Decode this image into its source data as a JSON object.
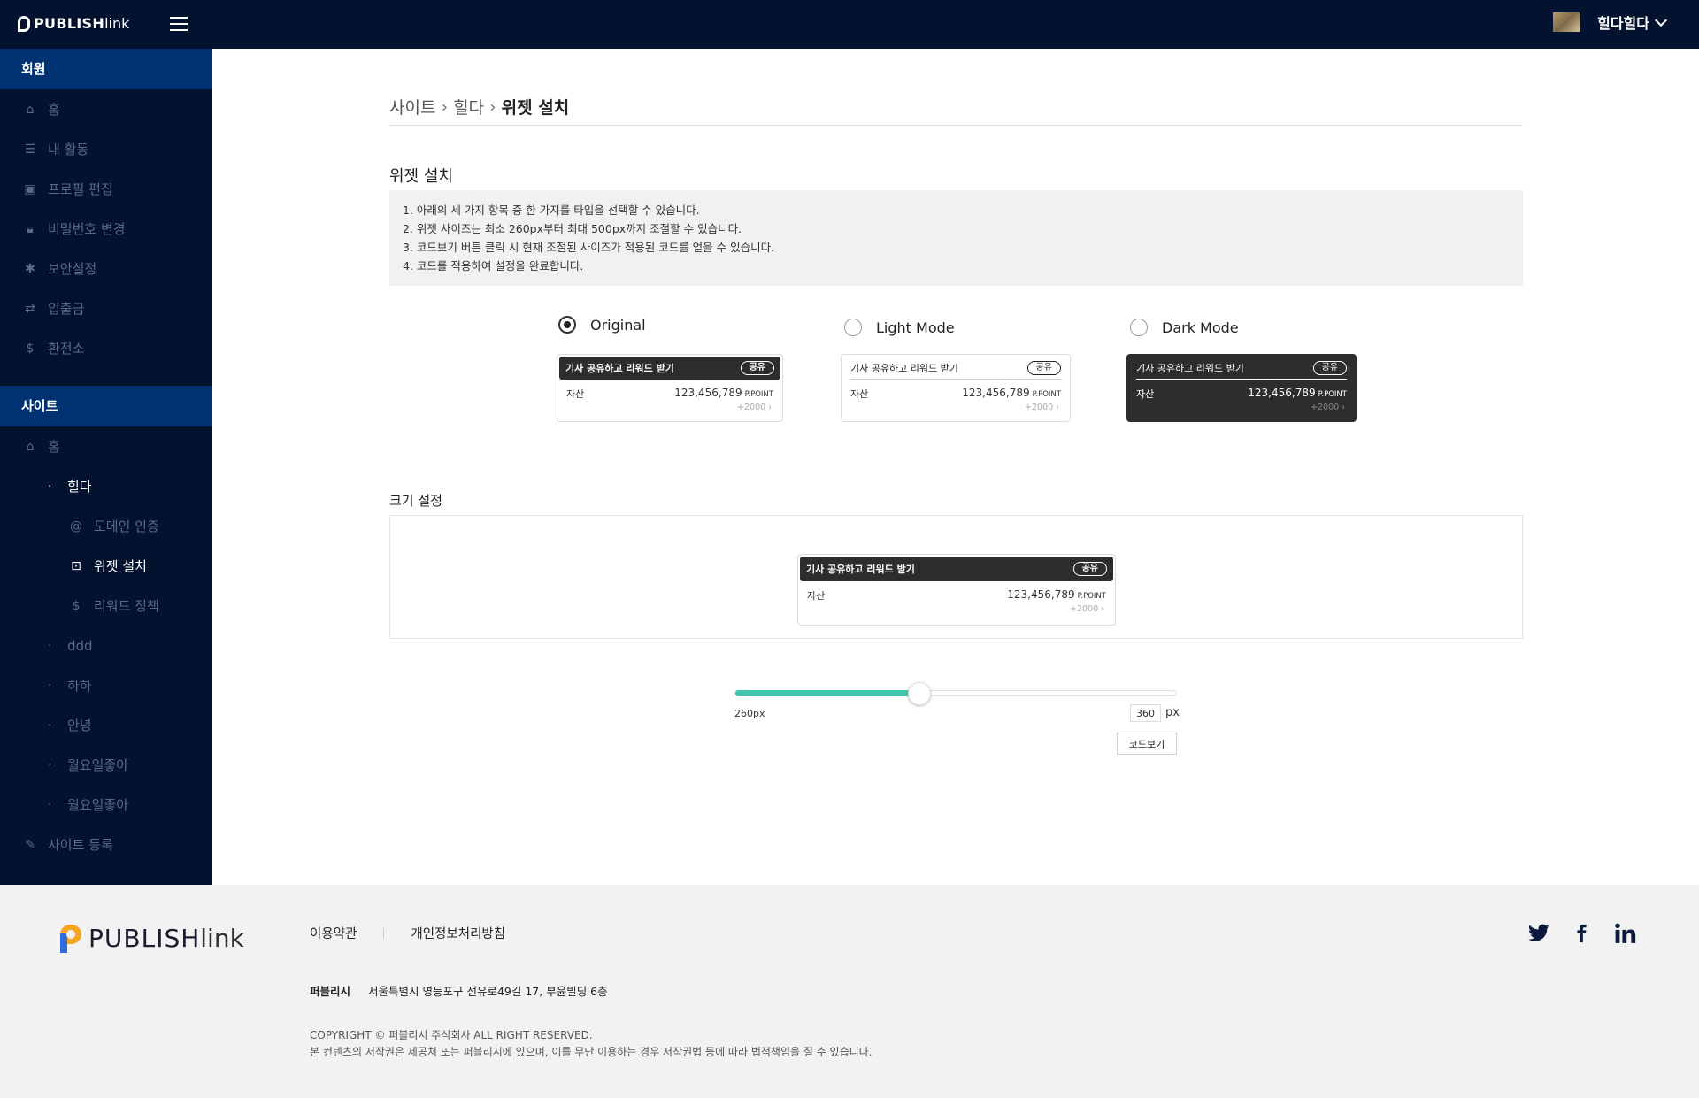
{
  "header": {
    "brand_bold": "PUBLISH",
    "brand_light": "link",
    "user_name": "힐다힐다"
  },
  "sidebar": {
    "section_member": "회원",
    "member_items": [
      {
        "label": "홈",
        "icon": "home-icon"
      },
      {
        "label": "내 활동",
        "icon": "list-icon"
      },
      {
        "label": "프로필 편집",
        "icon": "profile-icon"
      },
      {
        "label": "비밀번호 변경",
        "icon": "lock-icon"
      },
      {
        "label": "보안설정",
        "icon": "security-icon"
      },
      {
        "label": "입출금",
        "icon": "transfer-icon"
      },
      {
        "label": "환전소",
        "icon": "exchange-icon"
      }
    ],
    "section_site": "사이트",
    "site_items": {
      "home": "홈",
      "hilda": "힐다",
      "domain": "도메인 인증",
      "widget": "위젯 설치",
      "reward": "리워드 정책",
      "ddd": "ddd",
      "haha": "하하",
      "annyeong": "안녕",
      "monday1": "월요일좋아",
      "monday2": "월요일좋아",
      "register": "사이트 등록"
    }
  },
  "breadcrumb": {
    "site": "사이트",
    "hilda": "힐다",
    "current": "위젯 설치"
  },
  "section_title": "위젯 설치",
  "instructions": [
    "1. 아래의 세 가지 항목 중 한 가지를 타입을 선택할 수 있습니다.",
    "2. 위젯 사이즈는 최소 260px부터 최대 500px까지 조절할 수 있습니다.",
    "3. 코드보기 버튼 클릭 시 현재 조절된 사이즈가 적용된 코드를 얻을 수 있습니다.",
    "4. 코드를 적용하여 설정을 완료합니다."
  ],
  "modes": {
    "original": "Original",
    "light": "Light Mode",
    "dark": "Dark Mode",
    "selected": "original"
  },
  "widget": {
    "title": "기사 공유하고 리워드 받기",
    "share": "공유",
    "asset_label": "자산",
    "amount": "123,456,789",
    "unit": "P.POINT",
    "plus": "+2000 ›"
  },
  "size": {
    "title": "크기 설정",
    "min_label": "260px",
    "min": 260,
    "max": 500,
    "value": "360",
    "unit": "px",
    "code_button": "코드보기"
  },
  "footer": {
    "brand_bold": "PUBLISH",
    "brand_light": "link",
    "terms": "이용약관",
    "privacy": "개인정보처리방침",
    "company": "퍼블리시",
    "address": "서울특별시 영등포구 선유로49길 17, 부윤빌딩 6층",
    "copyright": "COPYRIGHT © 퍼블리시 주식회사 ALL RIGHT RESERVED.",
    "notice": "본 컨텐츠의 저작권은 제공처 또는 퍼블리시에 있으며, 이를 무단 이용하는 경우 저작권법 등에 따라 법적책임을 질 수 있습니다."
  },
  "colors": {
    "navy": "#03132f",
    "active_blue": "#003272",
    "slider": "#3ec8ad"
  }
}
